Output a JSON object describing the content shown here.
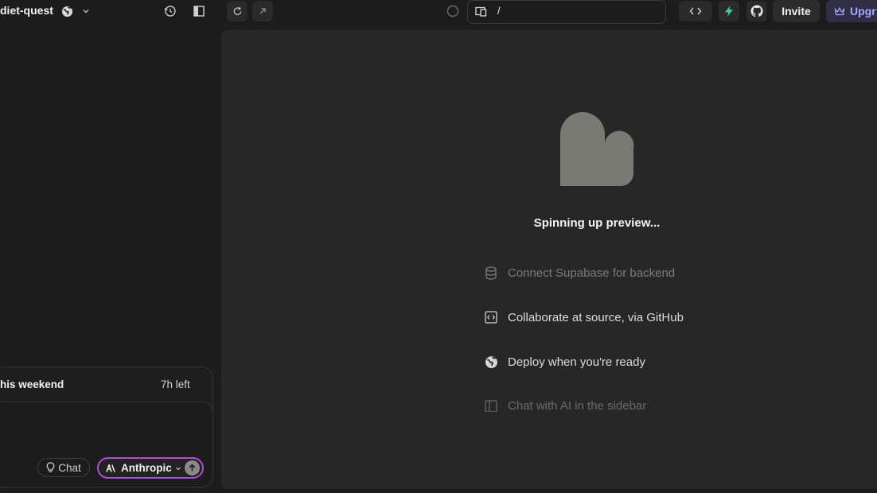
{
  "header": {
    "project_name": "diet-quest",
    "url_path": "/",
    "invite_label": "Invite",
    "upgrade_label": "Upgr"
  },
  "preview": {
    "status_text": "Spinning up preview...",
    "features": [
      {
        "label": "Connect Supabase for backend",
        "icon": "database-icon"
      },
      {
        "label": "Collaborate at source, via GitHub",
        "icon": "code-icon"
      },
      {
        "label": "Deploy when you're ready",
        "icon": "globe-icon"
      },
      {
        "label": "Chat with AI in the sidebar",
        "icon": "sidebar-icon"
      }
    ]
  },
  "chat": {
    "task_text": "his weekend",
    "time_left": "7h left",
    "chat_button_label": "Chat",
    "model_label": "Anthropic"
  },
  "colors": {
    "accent_upgrade": "#a9a6ff",
    "model_border": "#b04ad8",
    "bolt_green": "#3ecf8e",
    "heart_gray": "#7a7a74"
  }
}
